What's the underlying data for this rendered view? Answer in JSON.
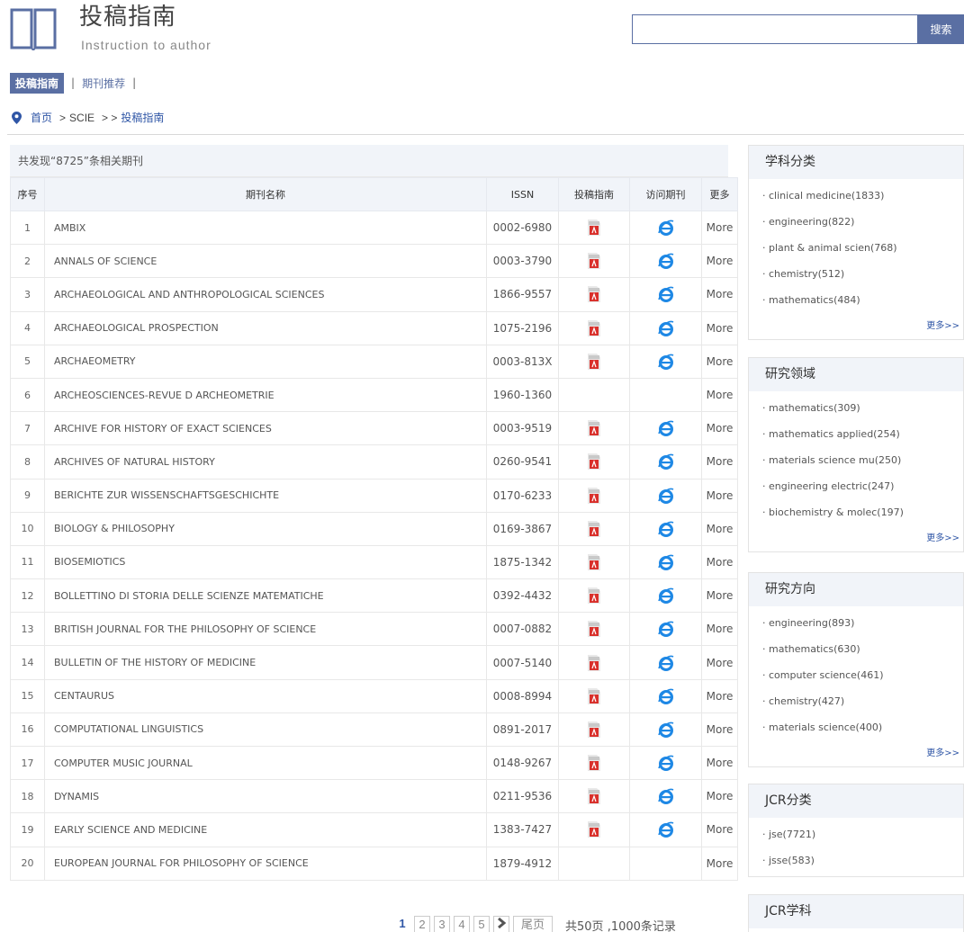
{
  "header": {
    "title_cn": "投稿指南",
    "title_en": "Instruction to author",
    "search_button": "搜索",
    "search_value": ""
  },
  "tabs": [
    {
      "label": "投稿指南",
      "active": true
    },
    {
      "label": "期刊推荐",
      "active": false
    }
  ],
  "breadcrumb": {
    "home": "首页",
    "sep1": ">",
    "level1": "SCIE",
    "sep2": "> >",
    "current": "投稿指南"
  },
  "summary": "共发现“8725”条相关期刊",
  "columns": {
    "num": "序号",
    "name": "期刊名称",
    "issn": "ISSN",
    "guide": "投稿指南",
    "visit": "访问期刊",
    "more": "更多"
  },
  "rows": [
    {
      "num": "1",
      "name": "AMBIX",
      "issn": "0002-6980",
      "pdf": true,
      "ie": true,
      "more": "More"
    },
    {
      "num": "2",
      "name": "ANNALS OF SCIENCE",
      "issn": "0003-3790",
      "pdf": true,
      "ie": true,
      "more": "More"
    },
    {
      "num": "3",
      "name": "ARCHAEOLOGICAL AND ANTHROPOLOGICAL SCIENCES",
      "issn": "1866-9557",
      "pdf": true,
      "ie": true,
      "more": "More"
    },
    {
      "num": "4",
      "name": "ARCHAEOLOGICAL PROSPECTION",
      "issn": "1075-2196",
      "pdf": true,
      "ie": true,
      "more": "More"
    },
    {
      "num": "5",
      "name": "ARCHAEOMETRY",
      "issn": "0003-813X",
      "pdf": true,
      "ie": true,
      "more": "More"
    },
    {
      "num": "6",
      "name": "ARCHEOSCIENCES-REVUE D ARCHEOMETRIE",
      "issn": "1960-1360",
      "pdf": false,
      "ie": false,
      "more": "More"
    },
    {
      "num": "7",
      "name": "ARCHIVE FOR HISTORY OF EXACT SCIENCES",
      "issn": "0003-9519",
      "pdf": true,
      "ie": true,
      "more": "More"
    },
    {
      "num": "8",
      "name": "ARCHIVES OF NATURAL HISTORY",
      "issn": "0260-9541",
      "pdf": true,
      "ie": true,
      "more": "More"
    },
    {
      "num": "9",
      "name": "BERICHTE ZUR WISSENSCHAFTSGESCHICHTE",
      "issn": "0170-6233",
      "pdf": true,
      "ie": true,
      "more": "More"
    },
    {
      "num": "10",
      "name": "BIOLOGY & PHILOSOPHY",
      "issn": "0169-3867",
      "pdf": true,
      "ie": true,
      "more": "More"
    },
    {
      "num": "11",
      "name": "BIOSEMIOTICS",
      "issn": "1875-1342",
      "pdf": true,
      "ie": true,
      "more": "More"
    },
    {
      "num": "12",
      "name": "BOLLETTINO DI STORIA DELLE SCIENZE MATEMATICHE",
      "issn": "0392-4432",
      "pdf": true,
      "ie": true,
      "more": "More"
    },
    {
      "num": "13",
      "name": "BRITISH JOURNAL FOR THE PHILOSOPHY OF SCIENCE",
      "issn": "0007-0882",
      "pdf": true,
      "ie": true,
      "more": "More"
    },
    {
      "num": "14",
      "name": "BULLETIN OF THE HISTORY OF MEDICINE",
      "issn": "0007-5140",
      "pdf": true,
      "ie": true,
      "more": "More"
    },
    {
      "num": "15",
      "name": "CENTAURUS",
      "issn": "0008-8994",
      "pdf": true,
      "ie": true,
      "more": "More"
    },
    {
      "num": "16",
      "name": "COMPUTATIONAL LINGUISTICS",
      "issn": "0891-2017",
      "pdf": true,
      "ie": true,
      "more": "More"
    },
    {
      "num": "17",
      "name": "COMPUTER MUSIC JOURNAL",
      "issn": "0148-9267",
      "pdf": true,
      "ie": true,
      "more": "More"
    },
    {
      "num": "18",
      "name": "DYNAMIS",
      "issn": "0211-9536",
      "pdf": true,
      "ie": true,
      "more": "More"
    },
    {
      "num": "19",
      "name": "EARLY SCIENCE AND MEDICINE",
      "issn": "1383-7427",
      "pdf": true,
      "ie": true,
      "more": "More"
    },
    {
      "num": "20",
      "name": "EUROPEAN JOURNAL FOR PHILOSOPHY OF SCIENCE",
      "issn": "1879-4912",
      "pdf": false,
      "ie": false,
      "more": "More"
    }
  ],
  "pagination": {
    "pages": [
      "1",
      "2",
      "3",
      "4",
      "5"
    ],
    "current": "1",
    "next": "›",
    "last": "尾页",
    "total": "共50页 ,1000条记录"
  },
  "sidebar": [
    {
      "title": "学科分类",
      "items": [
        "clinical medicine(1833)",
        "engineering(822)",
        "plant & animal scien(768)",
        "chemistry(512)",
        "mathematics(484)"
      ],
      "more": "更多>>"
    },
    {
      "title": "研究领域",
      "items": [
        "mathematics(309)",
        "mathematics applied(254)",
        "materials science mu(250)",
        "engineering electric(247)",
        "biochemistry & molec(197)"
      ],
      "more": "更多>>"
    },
    {
      "title": "研究方向",
      "items": [
        "engineering(893)",
        "mathematics(630)",
        "computer science(461)",
        "chemistry(427)",
        "materials science(400)"
      ],
      "more": "更多>>"
    },
    {
      "title": "JCR分类",
      "items": [
        "jse(7721)",
        "jsse(583)"
      ],
      "more": ""
    },
    {
      "title": "JCR学科",
      "items": [],
      "more": ""
    }
  ],
  "colors": {
    "accent": "#5a6fa3",
    "link": "#2f56a6",
    "header_bg": "#f1f4f9",
    "pdf_red": "#d9302b",
    "ie_blue": "#1e88e5"
  },
  "icons": {
    "logo": "book-icon",
    "breadcrumb": "location-pin-icon",
    "guide": "pdf-icon",
    "visit": "ie-browser-icon",
    "next": "chevron-right-icon"
  }
}
